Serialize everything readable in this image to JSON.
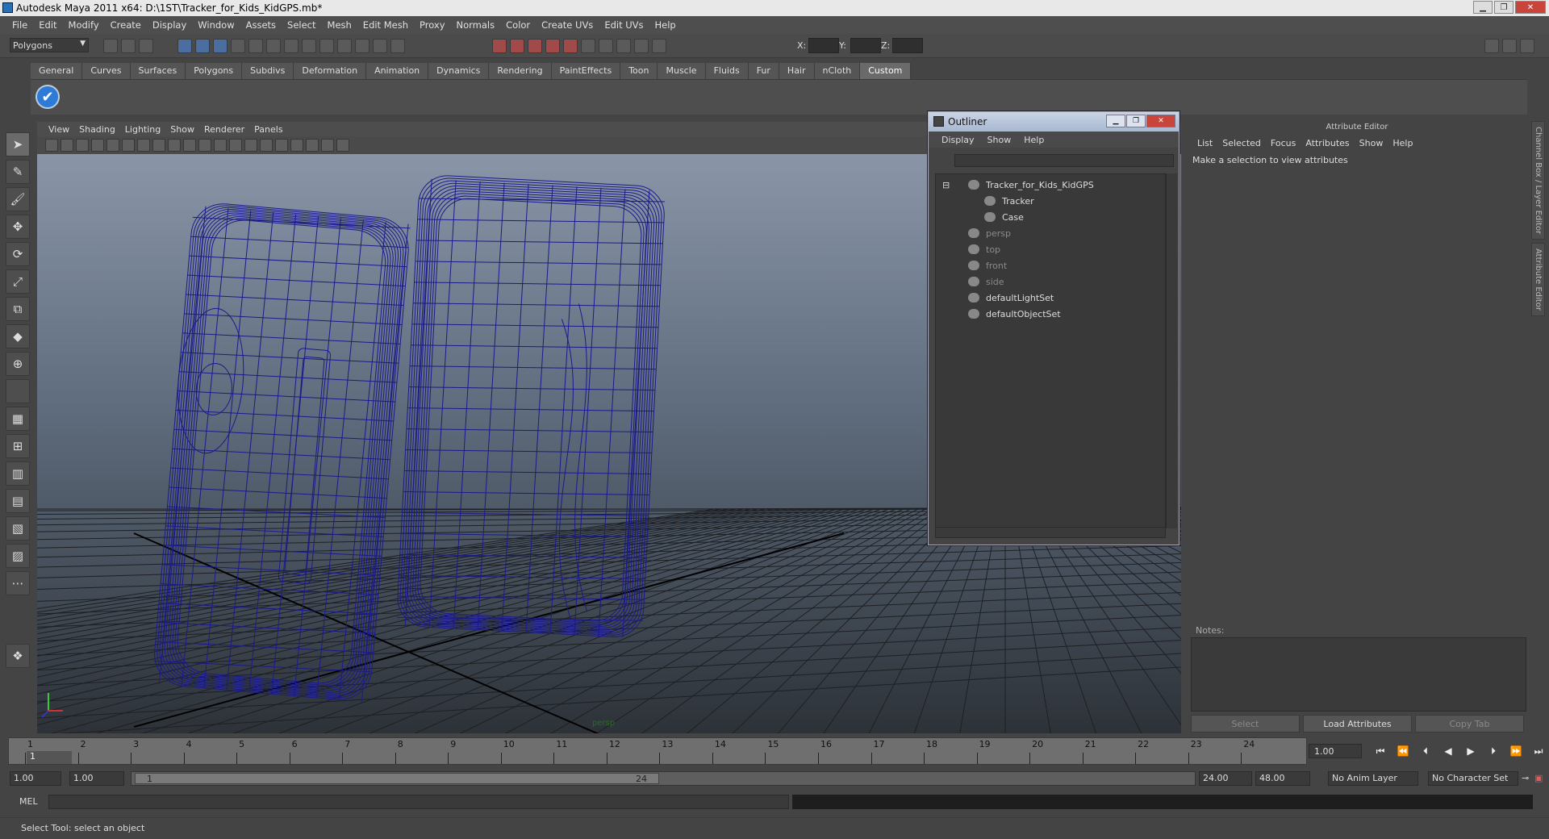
{
  "window": {
    "title": "Autodesk Maya 2011 x64: D:\\1ST\\Tracker_for_Kids_KidGPS.mb*"
  },
  "menubar": [
    "File",
    "Edit",
    "Modify",
    "Create",
    "Display",
    "Window",
    "Assets",
    "Select",
    "Mesh",
    "Edit Mesh",
    "Proxy",
    "Normals",
    "Color",
    "Create UVs",
    "Edit UVs",
    "Help"
  ],
  "status": {
    "mode": "Polygons",
    "x_label": "X:",
    "y_label": "Y:",
    "z_label": "Z:"
  },
  "shelf_tabs": [
    "General",
    "Curves",
    "Surfaces",
    "Polygons",
    "Subdivs",
    "Deformation",
    "Animation",
    "Dynamics",
    "Rendering",
    "PaintEffects",
    "Toon",
    "Muscle",
    "Fluids",
    "Fur",
    "Hair",
    "nCloth",
    "Custom"
  ],
  "shelf_active": "Custom",
  "viewport_menu": [
    "View",
    "Shading",
    "Lighting",
    "Show",
    "Renderer",
    "Panels"
  ],
  "viewport": {
    "camera_label": "persp"
  },
  "outliner": {
    "title": "Outliner",
    "menu": [
      "Display",
      "Show",
      "Help"
    ],
    "items": [
      {
        "label": "Tracker_for_Kids_KidGPS",
        "dim": false,
        "level": 0
      },
      {
        "label": "Tracker",
        "dim": false,
        "level": 1
      },
      {
        "label": "Case",
        "dim": false,
        "level": 1
      },
      {
        "label": "persp",
        "dim": true,
        "level": 0
      },
      {
        "label": "top",
        "dim": true,
        "level": 0
      },
      {
        "label": "front",
        "dim": true,
        "level": 0
      },
      {
        "label": "side",
        "dim": true,
        "level": 0
      },
      {
        "label": "defaultLightSet",
        "dim": false,
        "level": 0
      },
      {
        "label": "defaultObjectSet",
        "dim": false,
        "level": 0
      }
    ]
  },
  "attribute_editor": {
    "header": "Attribute Editor",
    "menu": [
      "List",
      "Selected",
      "Focus",
      "Attributes",
      "Show",
      "Help"
    ],
    "message": "Make a selection to view attributes",
    "notes_label": "Notes:",
    "buttons": {
      "select": "Select",
      "load": "Load Attributes",
      "copy": "Copy Tab"
    }
  },
  "side_tabs": [
    "Channel Box / Layer Editor",
    "Attribute Editor"
  ],
  "timeline": {
    "ticks": [
      "1",
      "2",
      "3",
      "4",
      "5",
      "6",
      "7",
      "8",
      "9",
      "10",
      "11",
      "12",
      "13",
      "14",
      "15",
      "16",
      "17",
      "18",
      "19",
      "20",
      "21",
      "22",
      "23",
      "24"
    ],
    "start_marker": "1",
    "current_frame": "1.00"
  },
  "range": {
    "start": "1.00",
    "anim_start": "1.00",
    "slider_start": "1",
    "slider_end": "24",
    "anim_end": "24.00",
    "end": "48.00",
    "anim_layer": "No Anim Layer",
    "char_set": "No Character Set"
  },
  "command": {
    "label": "MEL"
  },
  "help_line": "Select Tool: select an object"
}
